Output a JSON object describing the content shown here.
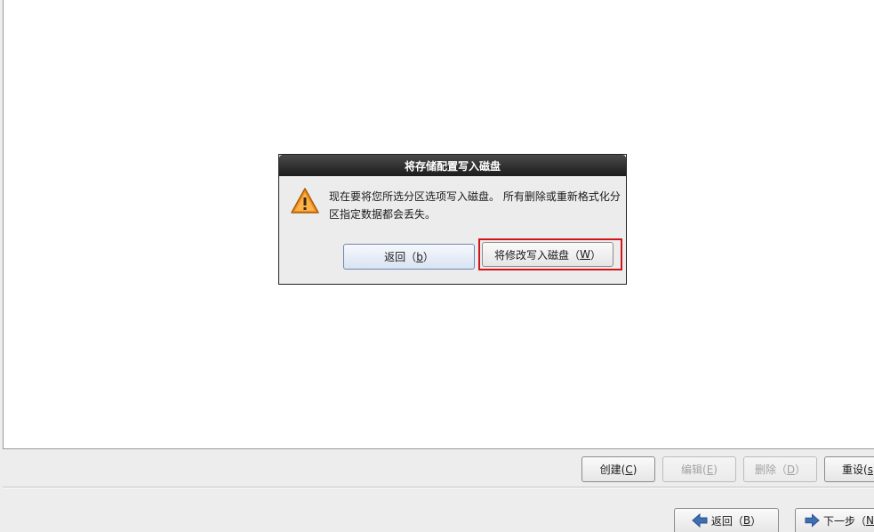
{
  "dialog": {
    "title": "将存储配置写入磁盘",
    "message": "现在要将您所选分区选项写入磁盘。 所有删除或重新格式化分区指定数据都会丢失。",
    "back_button": {
      "label": "返回（",
      "mnemonic": "b",
      "suffix": "）"
    },
    "write_button": {
      "label": "将修改写入磁盘（",
      "mnemonic": "W",
      "suffix": "）"
    }
  },
  "partition_actions": {
    "create": {
      "label": "创建(",
      "mnemonic": "C",
      "suffix": ")"
    },
    "edit": {
      "label": "编辑(",
      "mnemonic": "E",
      "suffix": ")"
    },
    "delete": {
      "label": "删除（",
      "mnemonic": "D",
      "suffix": "）"
    },
    "reset": {
      "label": "重设(",
      "mnemonic": "s",
      "suffix": ""
    }
  },
  "nav": {
    "back": {
      "label": "返回（",
      "mnemonic": "B",
      "suffix": "）"
    },
    "next": {
      "label": "下一步（",
      "mnemonic": "N",
      "suffix": ""
    }
  },
  "colors": {
    "focus_ring": "#d0141a",
    "titlebar": "#1c1c1c",
    "arrow_icon": "#3f6fb3",
    "warning_icon": "#f2901e"
  },
  "icons": {
    "warning": "warning-icon",
    "back": "arrow-left-icon",
    "next": "arrow-right-icon"
  }
}
